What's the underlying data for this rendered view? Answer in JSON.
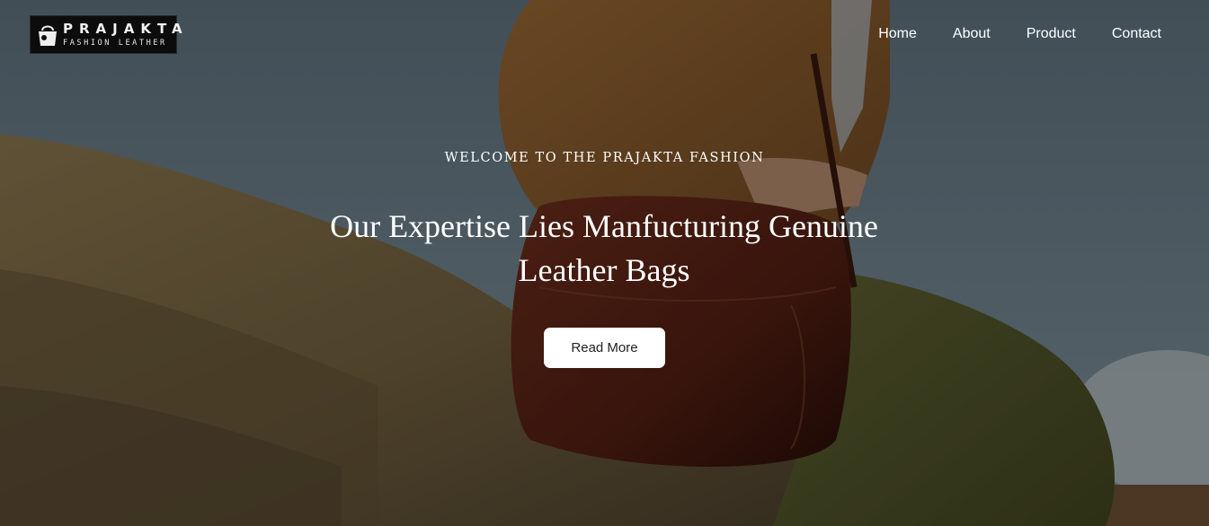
{
  "brand": {
    "name": "PRAJAKTA",
    "tagline": "FASHION LEATHER"
  },
  "nav": {
    "items": [
      {
        "label": "Home"
      },
      {
        "label": "About"
      },
      {
        "label": "Product"
      },
      {
        "label": "Contact"
      }
    ]
  },
  "hero": {
    "eyebrow": "WELCOME TO THE PRAJAKTA FASHION",
    "headline": "Our Expertise Lies Manfucturing Genuine Leather Bags",
    "cta_label": "Read More"
  },
  "colors": {
    "sky": "#6e8493",
    "rock": "#8a7650",
    "jacket": "#9b6a34",
    "bag": "#5a2114",
    "trousers": "#5e6230",
    "button_bg": "#ffffff"
  }
}
